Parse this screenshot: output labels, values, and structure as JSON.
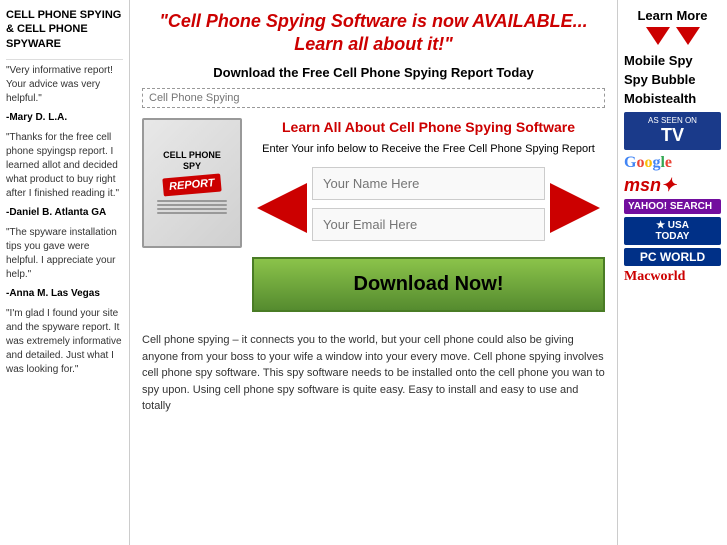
{
  "left_sidebar": {
    "title": "Cell Phone Spying & Cell Phone Spyware",
    "testimonials": [
      {
        "text": "\"Very informative report! Your advice was very helpful.\"",
        "author": "-Mary D. L.A."
      },
      {
        "text": "\"Thanks for the free cell phone spyingsp report. I learned allot and decided what product to buy right after I finished reading it.\"",
        "author": "-Daniel B. Atlanta GA"
      },
      {
        "text": "\"The spyware installation tips you gave were helpful. I appreciate your help.\"",
        "author": "-Anna M. Las Vegas"
      },
      {
        "text": "\"I'm glad I found your site and the spyware report. It was extremely informative and detailed. Just what I was looking for.\"",
        "author": ""
      }
    ]
  },
  "main": {
    "headline": "\"Cell Phone Spying Software is now AVAILABLE... Learn all about it!\"",
    "subheadline": "Download the Free Cell Phone Spying Report Today",
    "search_placeholder": "Cell Phone Spying",
    "book_title": "Cell Phone Spy",
    "book_badge": "REPORT",
    "signup_headline": "Learn All About Cell Phone Spying Software",
    "signup_sub": "Enter Your info below to Receive the Free Cell Phone Spying Report",
    "name_placeholder": "Your Name Here",
    "email_placeholder": "Your Email Here",
    "download_btn": "Download Now!",
    "body_text": "Cell phone spying – it connects you to the world, but your cell phone could also be giving anyone from your boss to your wife a window into your every move. Cell phone spying involves cell phone spy software. This spy software needs to be installed onto the cell phone you wan to spy upon. Using cell phone spy software is quite easy. Easy to install and easy to use and totally"
  },
  "right_sidebar": {
    "learn_more": "Learn More",
    "links": [
      "Mobile Spy",
      "Spy Bubble",
      "Mobistealth"
    ],
    "badges": [
      "Google",
      "msn",
      "YAHOO! SEARCH",
      "USA TODAY",
      "PC WORLD",
      "Macworld"
    ]
  }
}
